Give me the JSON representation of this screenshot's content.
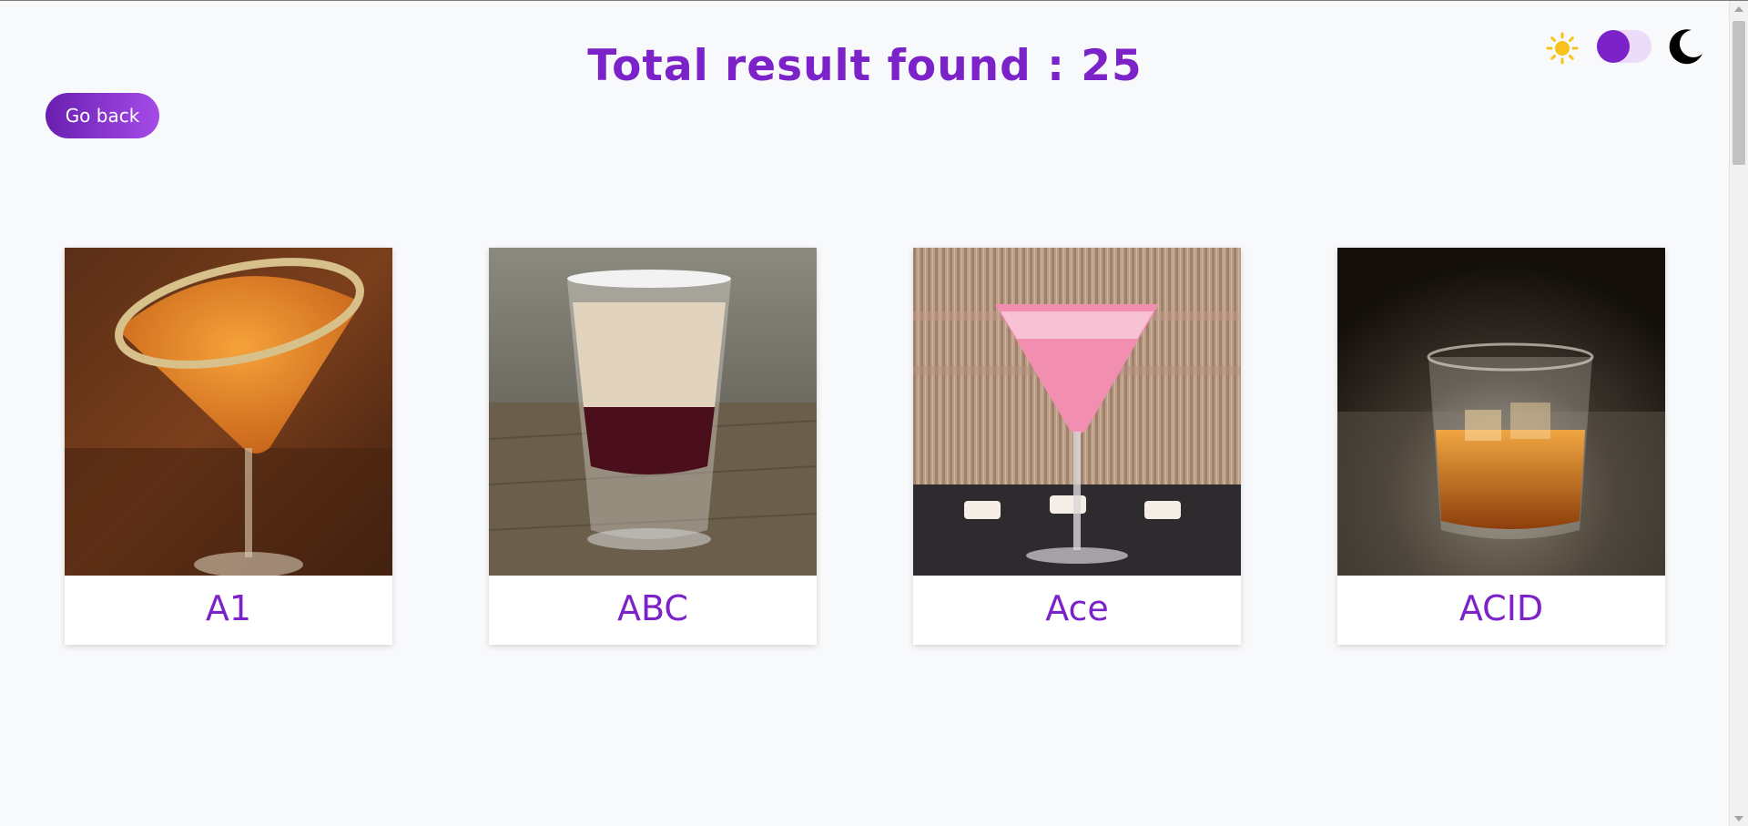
{
  "header": {
    "title": "Total result found : 25",
    "go_back_label": "Go back"
  },
  "theme_switch": {
    "light_icon": "sun-icon",
    "dark_icon": "moon-icon",
    "toggle_state": "light"
  },
  "results": [
    {
      "name": "A1",
      "image": "orange-martini-sugar-rim"
    },
    {
      "name": "ABC",
      "image": "layered-shot-glass"
    },
    {
      "name": "Ace",
      "image": "pink-martini-candles"
    },
    {
      "name": "ACID",
      "image": "whiskey-on-rocks"
    }
  ],
  "colors": {
    "accent": "#7b22c9",
    "button_gradient_start": "#6a1fb0",
    "button_gradient_end": "#a54be8",
    "sun": "#f7c21b",
    "background": "#f8f9fb"
  }
}
